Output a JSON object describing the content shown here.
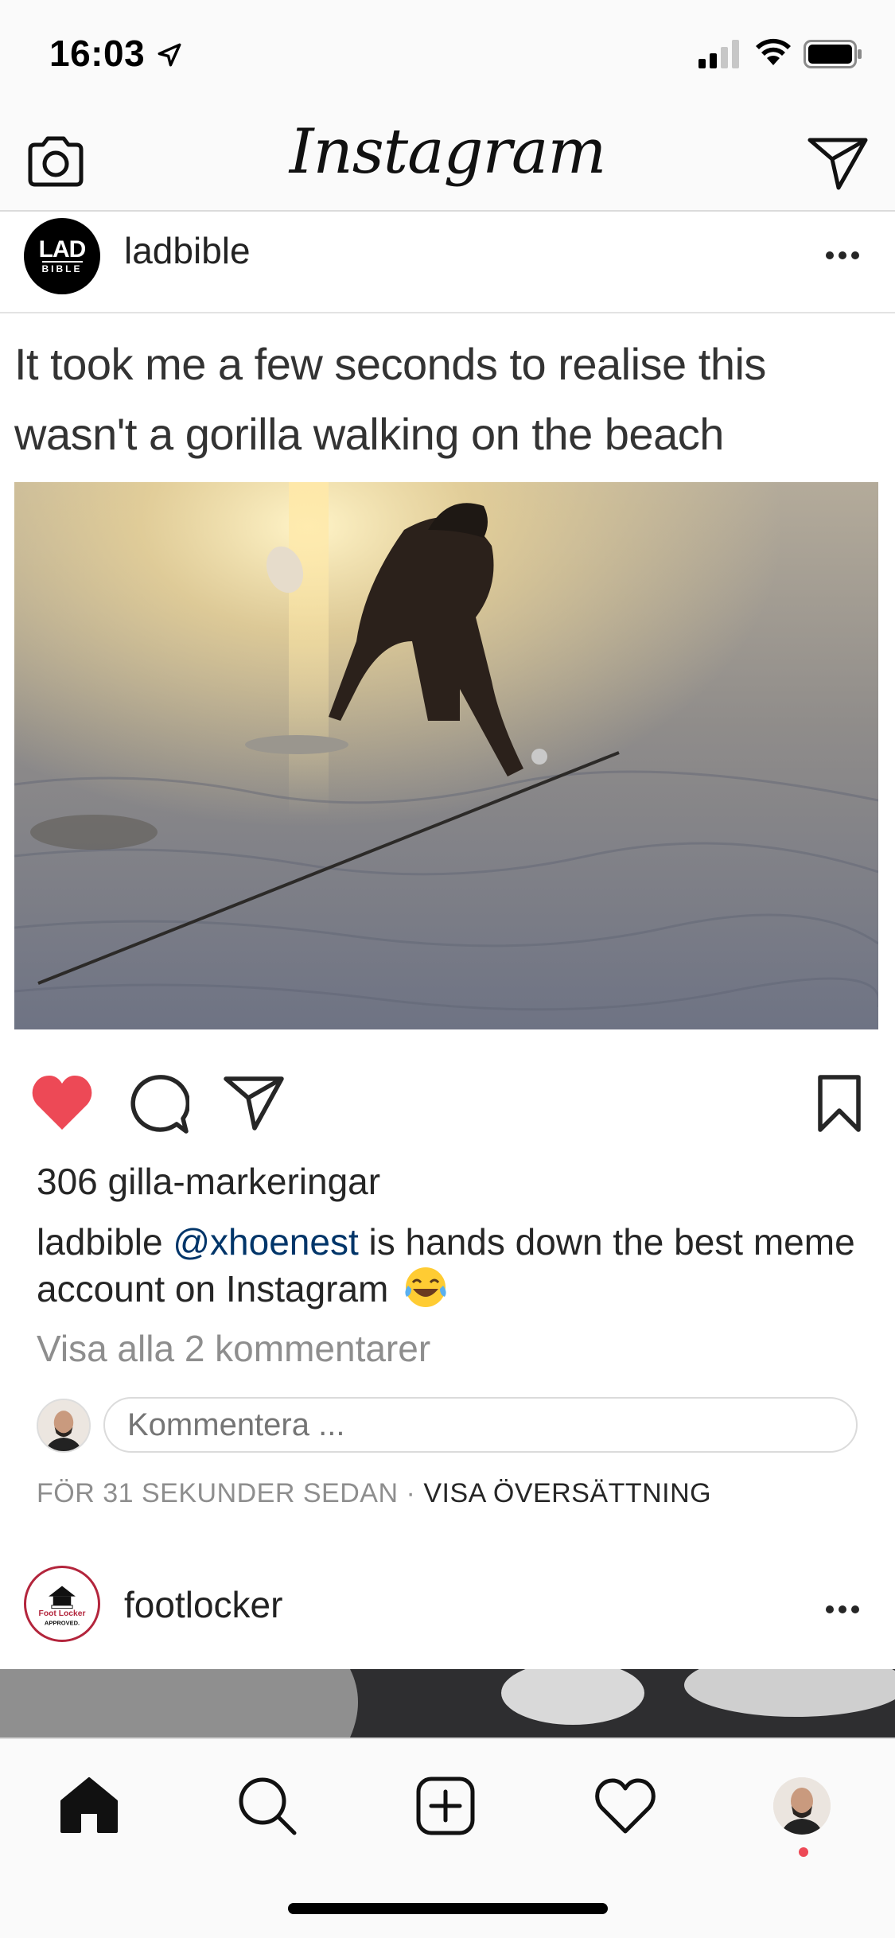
{
  "status_bar": {
    "time": "16:03",
    "icons": [
      "location-arrow-icon",
      "signal-icon",
      "wifi-icon",
      "battery-icon"
    ]
  },
  "nav": {
    "brand": "Instagram",
    "left_icon": "camera-icon",
    "right_icon": "send-icon"
  },
  "post": {
    "username": "ladbible",
    "avatar_text": {
      "top": "LAD",
      "bottom": "BIBLE"
    },
    "image_text": "It took me a few seconds to realise this wasn't a gorilla walking on the beach",
    "liked": true,
    "likes": "306 gilla-markeringar",
    "caption": {
      "username": "ladbible",
      "mention": "@xhoenest",
      "text": " is hands down the best meme account on Instagram"
    },
    "view_comments": "Visa alla 2 kommentarer",
    "comment_placeholder": "Kommentera ...",
    "time_ago": "FÖR 31 SEKUNDER SEDAN",
    "separator": "·",
    "translate": "VISA ÖVERSÄTTNING"
  },
  "post2": {
    "username": "footlocker",
    "avatar_text": {
      "top": "Foot Locker",
      "bottom": "APPROVED."
    }
  },
  "tabs": [
    "home-icon",
    "search-icon",
    "add-post-icon",
    "activity-heart-icon",
    "profile-avatar"
  ],
  "colors": {
    "like_red": "#ed4956",
    "mention_blue": "#003569",
    "muted_gray": "#8e8e8e",
    "footlocker_red": "#b3253c"
  }
}
